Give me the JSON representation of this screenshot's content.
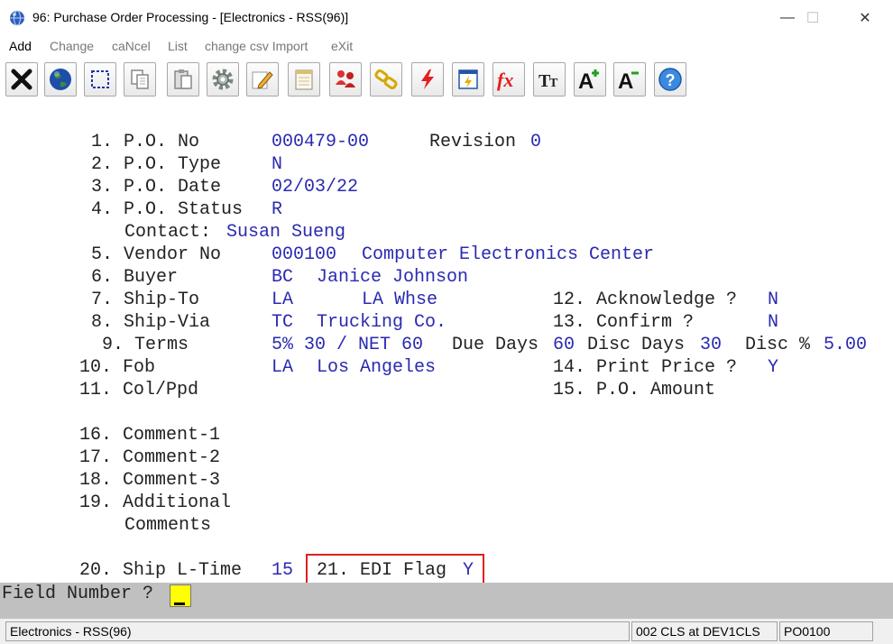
{
  "window": {
    "title": "96: Purchase Order Processing - [Electronics - RSS(96)]",
    "minimize": "—",
    "maximize": "☐",
    "close": "✕"
  },
  "menu": [
    "Add",
    "Change",
    "caNcel",
    "List",
    "change csv Import",
    "eXit"
  ],
  "toolbar_icons": [
    "close-x-icon",
    "globe-icon",
    "select-icon",
    "copy-icon",
    "paste-icon",
    "settings-gear-icon",
    "edit-pencil-icon",
    "notepad-icon",
    "users-icon",
    "link-icon",
    "lightning-icon",
    "report-icon",
    "function-fx-icon",
    "text-size-icon",
    "font-larger-icon",
    "font-smaller-icon",
    "help-icon"
  ],
  "form": {
    "f1_label": "1. P.O. No",
    "po_no": "000479-00",
    "revision_label": "Revision",
    "revision": "0",
    "f2_label": "2. P.O. Type",
    "po_type": "N",
    "f3_label": "3. P.O. Date",
    "po_date": "02/03/22",
    "f4_label": "4. P.O. Status",
    "po_status": "R",
    "contact_label": "Contact:",
    "contact": "Susan Sueng",
    "f5_label": "5. Vendor No",
    "vendor_no": "000100",
    "vendor_name": "Computer Electronics Center",
    "f6_label": "6. Buyer",
    "buyer_code": "BC",
    "buyer_name": "Janice Johnson",
    "f7_label": "7. Ship-To",
    "shipto_code": "LA",
    "shipto_name": "LA Whse",
    "f12_label": "12. Acknowledge ?",
    "acknowledge": "N",
    "f8_label": "8. Ship-Via",
    "shipvia_code": "TC",
    "shipvia_name": "Trucking Co.",
    "f13_label": "13. Confirm ?",
    "confirm": "N",
    "f9_label": "9. Terms",
    "terms": "5% 30 / NET 60",
    "due_days_label": "Due Days",
    "due_days": "60",
    "disc_days_label": "Disc Days",
    "disc_days": "30",
    "disc_pct_label": "Disc %",
    "disc_pct": "5.00",
    "f10_label": "10. Fob",
    "fob_code": "LA",
    "fob_name": "Los Angeles",
    "f14_label": "14. Print Price ?",
    "print_price": "Y",
    "f11_label": "11. Col/Ppd",
    "f15_label": "15. P.O. Amount",
    "f16_label": "16. Comment-1",
    "f17_label": "17. Comment-2",
    "f18_label": "18. Comment-3",
    "f19_label": "19. Additional",
    "f19_label2": "Comments",
    "f20_label": "20. Ship L-Time",
    "ship_lead_time": "15",
    "f21_label": "21. EDI Flag",
    "edi_flag": "Y"
  },
  "prompt": {
    "label": "Field Number ?"
  },
  "status": {
    "company": "Electronics - RSS(96)",
    "session": "002 CLS at DEV1CLS",
    "program": "PO0100"
  }
}
